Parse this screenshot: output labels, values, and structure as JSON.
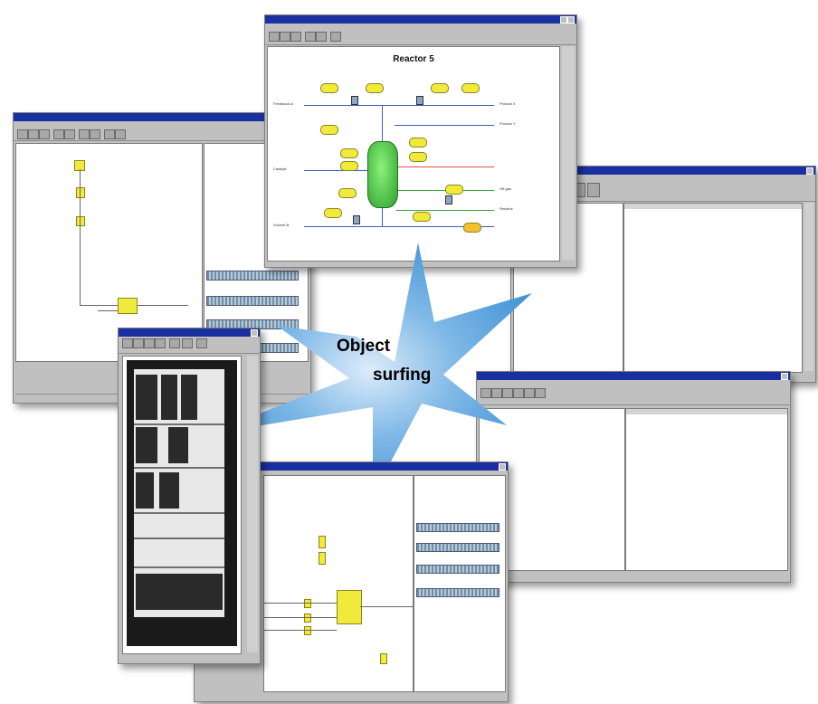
{
  "reactor_window": {
    "title": "Reactor 5",
    "inflows": [
      "Feedstock A",
      "Catalyst",
      "Solvent B"
    ],
    "outflows": [
      "Product X",
      "Product Y",
      "Off-gas",
      "Residue"
    ]
  },
  "callout": {
    "line1": "Object",
    "line2": "surfing"
  },
  "accent_colors": {
    "titlebar": "#1a2fa0",
    "star": "#4a9ad8",
    "vessel": "#3cc83c",
    "symbol": "#f2ea3a"
  }
}
